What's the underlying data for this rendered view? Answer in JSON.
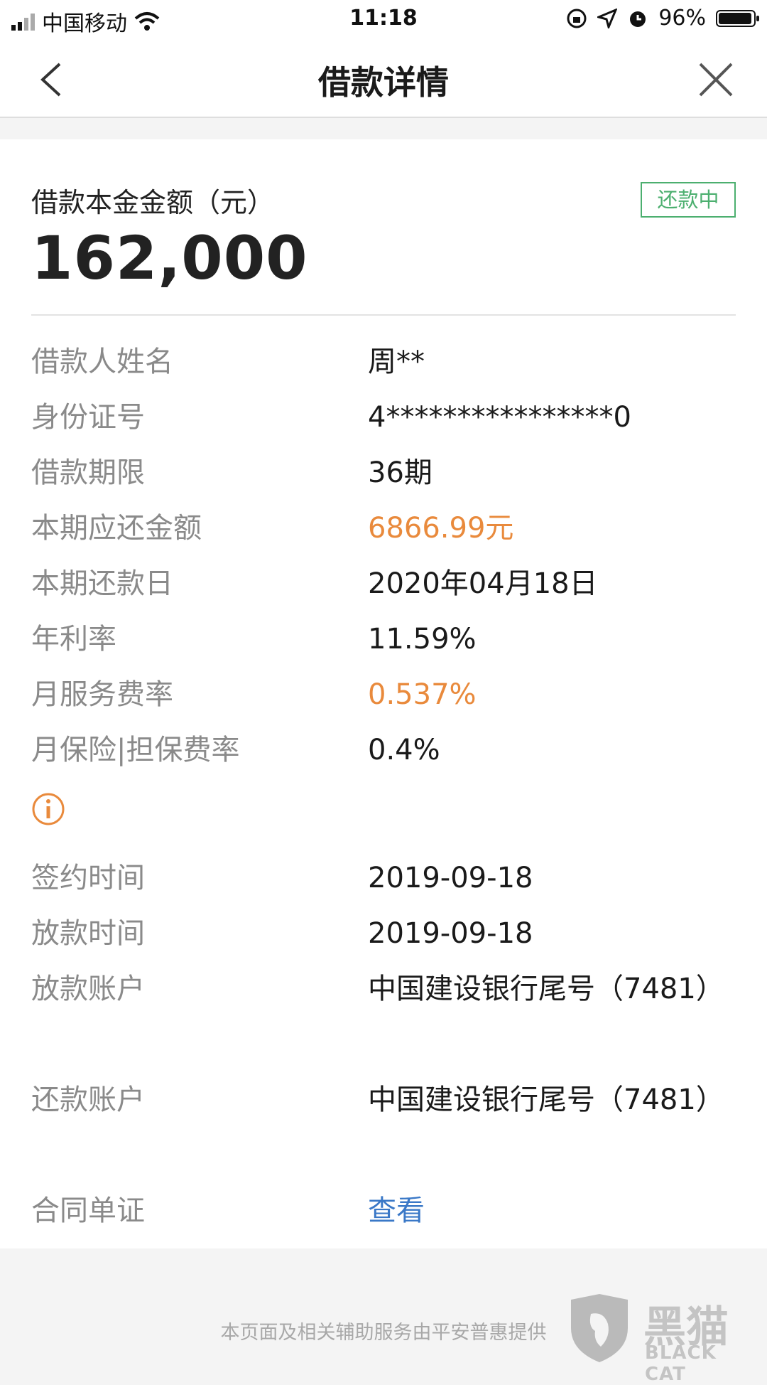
{
  "status_bar": {
    "carrier": "中国移动",
    "time": "11:18",
    "battery": "96%",
    "battery_level": 0.96
  },
  "header": {
    "title": "借款详情"
  },
  "loan": {
    "amount_label": "借款本金金额（元）",
    "amount": "162,000",
    "status": "还款中"
  },
  "details": [
    {
      "label": "借款人姓名",
      "value": "周**"
    },
    {
      "label": "身份证号",
      "value": "4****************0"
    },
    {
      "label": "借款期限",
      "value": "36期"
    },
    {
      "label": "本期应还金额",
      "value": "6866.99元"
    },
    {
      "label": "本期还款日",
      "value": "2020年04月18日"
    },
    {
      "label": "年利率",
      "value": "11.59%"
    },
    {
      "label": "月服务费率",
      "value": "0.537%"
    },
    {
      "label": "月保险|担保费率",
      "value": "0.4%"
    },
    {
      "label": "签约时间",
      "value": "2019-09-18"
    },
    {
      "label": "放款时间",
      "value": "2019-09-18"
    },
    {
      "label": "放款账户",
      "value": "中国建设银行尾号（7481）"
    },
    {
      "label": "还款账户",
      "value": "中国建设银行尾号（7481）"
    },
    {
      "label": "合同单证",
      "value": "查看"
    }
  ],
  "footer": {
    "text": "本页面及相关辅助服务由平安普惠提供",
    "watermark_cn": "黑猫",
    "watermark_en": "BLACK CAT"
  },
  "colors": {
    "accent_orange": "#e98a3c",
    "status_green": "#4caf6f",
    "link_blue": "#3a78c7"
  }
}
